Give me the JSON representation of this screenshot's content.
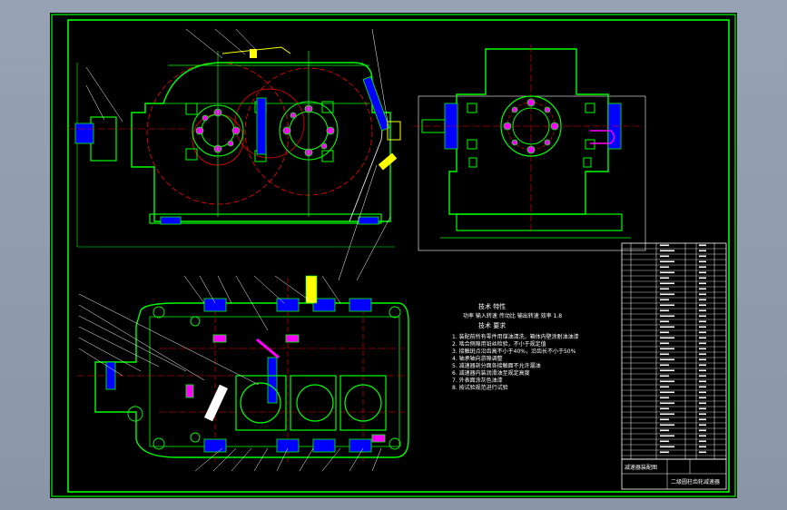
{
  "drawing": {
    "tech_title": "技术 特性",
    "tech_spec_line": "功率  输入转速 传动比  输出转速 效率  1.8",
    "req_title": "技术 要求",
    "req_lines": [
      "1. 装配前所有零件用煤油清洗，箱体内壁涂耐油油漆",
      "2. 啮合侧隙用铅丝检验，不小于规定值",
      "3. 接触斑点沿齿高不小于40%，沿齿长不小于50%",
      "4. 轴承轴向游隙调整",
      "5. 减速器剖分面各接触面不允许漏油",
      "6. 减速器内装润滑油至规定高度",
      "7. 外表面涂灰色油漆",
      "8. 按试验规范进行试验"
    ],
    "title_block_left": "减速器装配图",
    "title_block_right": "二级圆柱齿轮减速器"
  },
  "colors": {
    "frame": "#00ff00",
    "outline": "#00ff00",
    "center_line": "#ff0000",
    "hatch": "#0000ff",
    "dimension": "#ffffff",
    "leader": "#ffffff",
    "highlight": "#ffff00",
    "accent": "#00ffff",
    "viewport_bg": "#8e9aab",
    "sheet_bg": "#000000"
  }
}
